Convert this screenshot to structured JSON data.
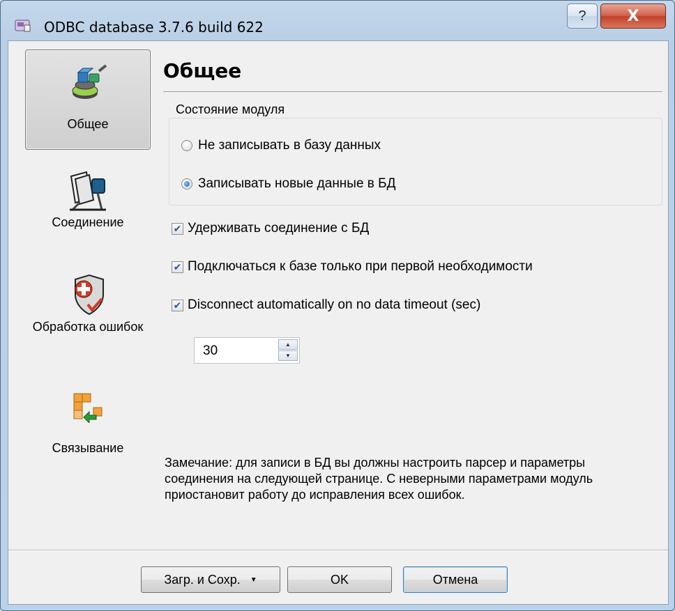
{
  "window": {
    "title": "ODBC database 3.7.6 build 622",
    "help_glyph": "?",
    "close_glyph": "X"
  },
  "sidebar": {
    "items": [
      {
        "label": "Общее",
        "icon": "general-settings-icon",
        "active": true
      },
      {
        "label": "Соединение",
        "icon": "connection-icon",
        "active": false
      },
      {
        "label": "Обработка ошибок",
        "icon": "error-handling-icon",
        "active": false
      },
      {
        "label": "Связывание",
        "icon": "binding-icon",
        "active": false
      }
    ]
  },
  "main": {
    "heading": "Общее",
    "module_state": {
      "legend": "Состояние модуля",
      "options": [
        {
          "label": "Не записывать в базу данных",
          "checked": false
        },
        {
          "label": "Записывать новые данные в БД",
          "checked": true
        }
      ]
    },
    "checkboxes": [
      {
        "label": "Удерживать соединение с БД",
        "checked": true
      },
      {
        "label": "Подключаться к базе только при первой необходимости",
        "checked": true
      },
      {
        "label": "Disconnect automatically on no data timeout (sec)",
        "checked": true
      }
    ],
    "timeout_value": "30",
    "note": "Замечание: для записи в БД вы должны настроить парсер и параметры соединения на следующей странице. С неверными параметрами модуль приостановит работу до исправления всех ошибок."
  },
  "footer": {
    "load_save_label": "Загр. и Сохр.",
    "ok_label": "OK",
    "cancel_label": "Отмена"
  },
  "colors": {
    "title_bar": "#c4d7ea",
    "close_button": "#c2402a",
    "client_bg": "#f0f0f0"
  }
}
